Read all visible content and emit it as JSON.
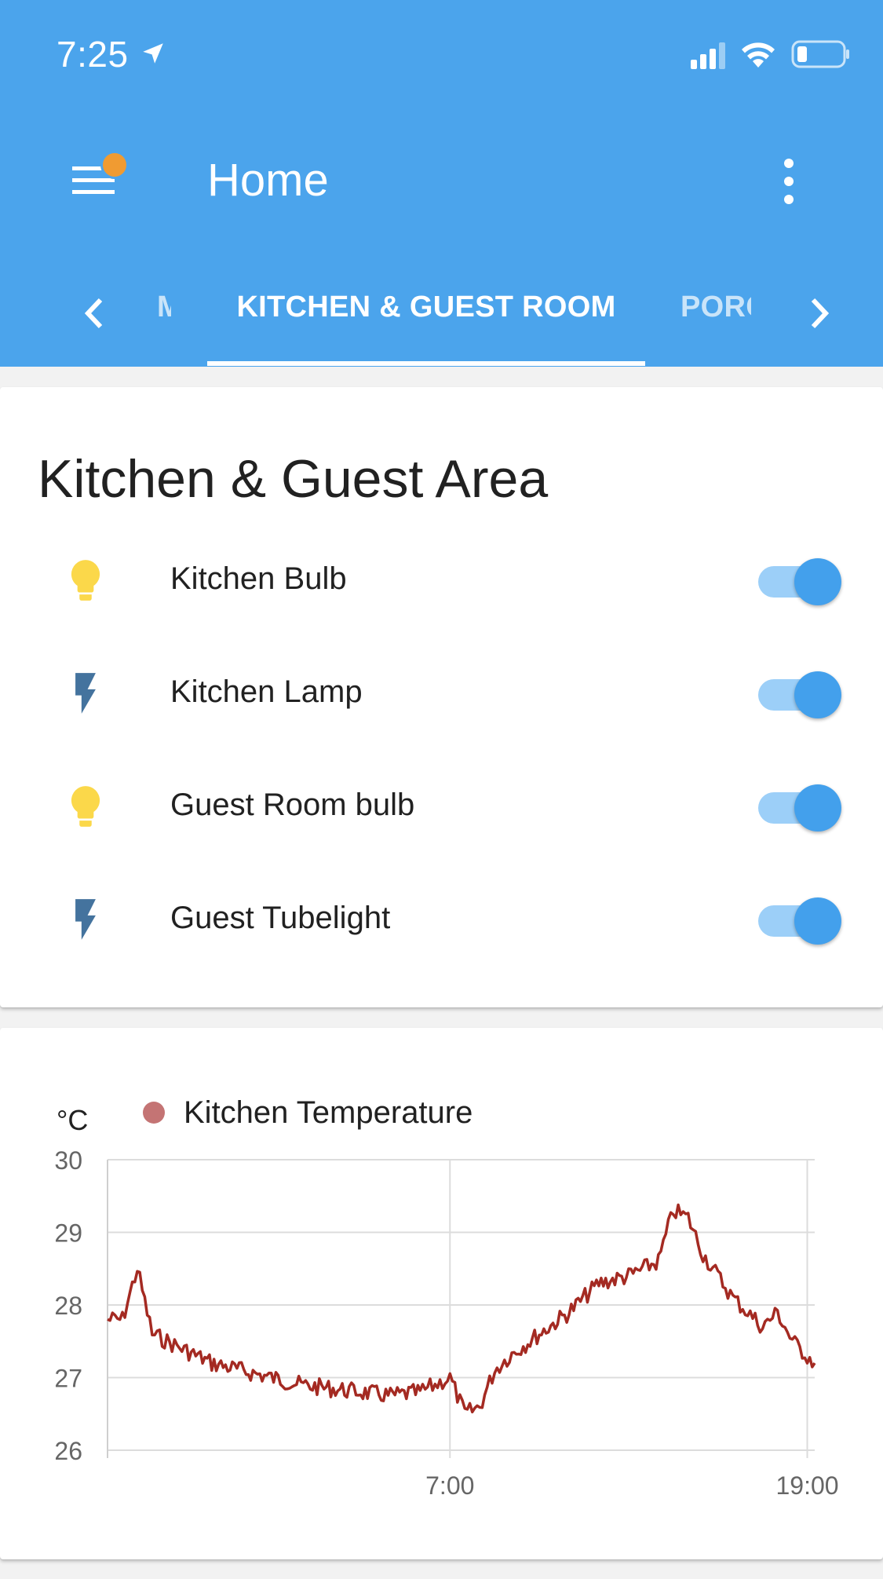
{
  "status_bar": {
    "time": "7:25",
    "location_icon": "location-arrow-icon",
    "signal_icon": "cellular-signal-icon",
    "wifi_icon": "wifi-icon",
    "battery_icon": "battery-low-icon"
  },
  "toolbar": {
    "menu_icon": "hamburger-menu-icon",
    "title": "Home",
    "overflow_icon": "more-vertical-icon"
  },
  "tabs": {
    "prev_arrow": "chevron-left-icon",
    "next_arrow": "chevron-right-icon",
    "prev_label": "M",
    "active_label": "KITCHEN & GUEST ROOM",
    "next_label": "PORCH"
  },
  "entities_card": {
    "title": "Kitchen & Guest Area",
    "items": [
      {
        "name": "Kitchen Bulb",
        "icon": "lightbulb-icon",
        "state": "on"
      },
      {
        "name": "Kitchen Lamp",
        "icon": "flash-icon",
        "state": "on"
      },
      {
        "name": "Guest Room bulb",
        "icon": "lightbulb-icon",
        "state": "on"
      },
      {
        "name": "Guest Tubelight",
        "icon": "flash-icon",
        "state": "on"
      }
    ]
  },
  "colors": {
    "header": "#4ba4ec",
    "toggle_on": "#43a0ec",
    "bulb": "#fbd84a",
    "flash": "#44739e",
    "series_line": "#a42a22",
    "legend_dot": "#c47474"
  },
  "chart_data": {
    "type": "line",
    "ylabel": "°C",
    "ylim": [
      26,
      30
    ],
    "yticks": [
      "30",
      "29",
      "28",
      "27",
      "26"
    ],
    "xlim": [
      "19:30",
      "19:15"
    ],
    "xticks": [
      "7:00",
      "19:00"
    ],
    "grid": true,
    "legend_placement": "top-left",
    "series": [
      {
        "name": "Kitchen Temperature",
        "x": [
          "19:30",
          "20:00",
          "20:30",
          "21:00",
          "21:30",
          "22:00",
          "23:00",
          "0:00",
          "1:00",
          "2:00",
          "3:00",
          "4:00",
          "5:00",
          "6:00",
          "6:30",
          "7:00",
          "7:30",
          "8:00",
          "8:30",
          "9:00",
          "10:00",
          "11:00",
          "12:00",
          "13:00",
          "14:00",
          "14:30",
          "15:00",
          "15:30",
          "16:00",
          "16:30",
          "17:00",
          "17:30",
          "18:00",
          "18:30",
          "19:00",
          "19:15"
        ],
        "values": [
          27.8,
          27.8,
          28.5,
          27.6,
          27.5,
          27.4,
          27.2,
          27.1,
          27.0,
          26.9,
          26.85,
          26.8,
          26.75,
          26.8,
          26.9,
          27.0,
          26.5,
          26.6,
          27.1,
          27.3,
          27.6,
          27.9,
          28.3,
          28.4,
          28.6,
          29.3,
          29.2,
          28.7,
          28.4,
          28.1,
          27.9,
          27.7,
          27.9,
          27.5,
          27.3,
          27.2
        ]
      }
    ]
  }
}
